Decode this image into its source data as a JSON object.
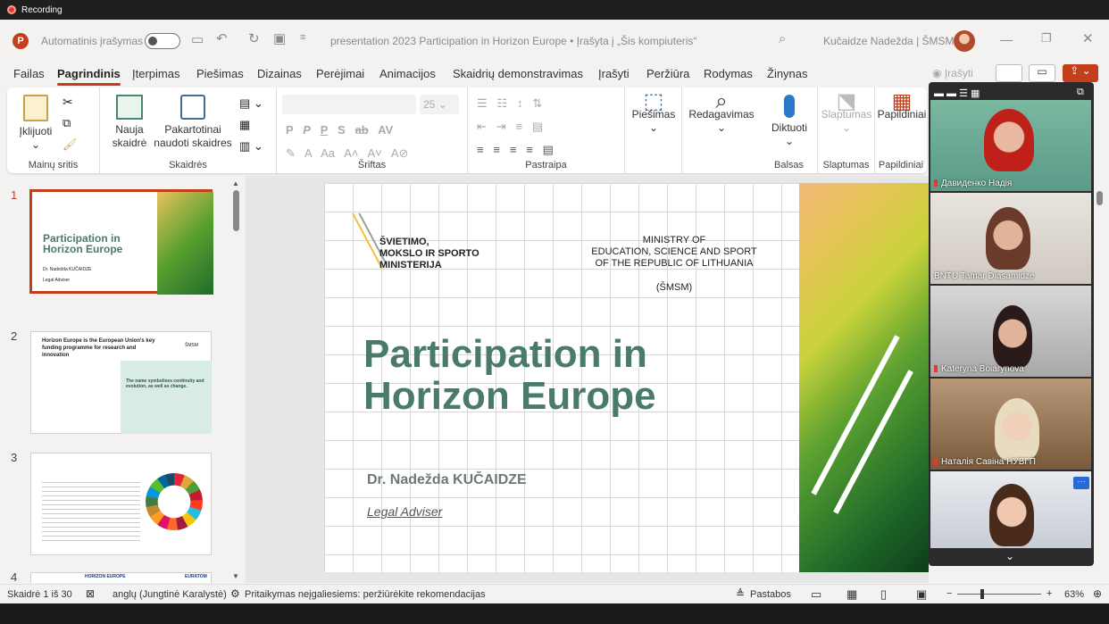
{
  "recording": {
    "label": "Recording"
  },
  "titlebar": {
    "autosave_label": "Automatinis įrašymas",
    "doc_title": "presentation 2023 Participation in Horizon Europe • Įrašyta į „Šis kompiuteris“",
    "user": "Kučaidze Nadežda | ŠMSM"
  },
  "menu": {
    "tabs": [
      "Failas",
      "Pagrindinis",
      "Įterpimas",
      "Piešimas",
      "Dizainas",
      "Perėjimai",
      "Animacijos",
      "Skaidrių demonstravimas",
      "Įrašyti",
      "Peržiūra",
      "Rodymas",
      "Žinynas"
    ],
    "record_label": "Įrašyti"
  },
  "ribbon": {
    "paste": "Įklijuoti",
    "clipboard_group": "Mainų sritis",
    "new_slide": "Nauja skaidrė",
    "reuse_slides": "Pakartotinai naudoti skaidres",
    "slides_group": "Skaidrės",
    "font_size": "25",
    "font_group": "Šriftas",
    "paragraph_group": "Pastraipa",
    "drawing": "Piešimas",
    "editing": "Redagavimas",
    "dictate": "Diktuoti",
    "voice_group": "Balsas",
    "sensitivity": "Slaptumas",
    "sensitivity_group": "Slaptumas",
    "addins": "Papildiniai",
    "addins_group": "Papildiniai"
  },
  "thumbnails": [
    {
      "num": "1",
      "title": "Participation in Horizon Europe",
      "author": "Dr. Nadežda KUČAIDZE",
      "role": "Legal Adviser"
    },
    {
      "num": "2",
      "heading": "Horizon Europe is the European Union's key funding programme for research and innovation",
      "tag": "ŠMSM",
      "note": "The name symbolises continuity and evolution, as well as change."
    },
    {
      "num": "3"
    },
    {
      "num": "4",
      "left": "HORIZON EUROPE",
      "right": "EURATOM"
    }
  ],
  "slide": {
    "ministry_lt": [
      "ŠVIETIMO,",
      "MOKSLO IR SPORTO",
      "MINISTERIJA"
    ],
    "ministry_en": [
      "MINISTRY OF",
      "EDUCATION, SCIENCE AND SPORT",
      "OF THE REPUBLIC OF LITHUANIA"
    ],
    "abbr": "(ŠMSM)",
    "title_line1": "Participation in",
    "title_line2": "Horizon Europe",
    "author": "Dr. Nadežda KUČAIDZE",
    "role": "Legal Adviser"
  },
  "participants": [
    {
      "name": "Давиденко Надія",
      "muted": true
    },
    {
      "name": "BNTU Tamar Diasamidze",
      "muted": false
    },
    {
      "name": "Kateryna Boiarynova",
      "muted": true
    },
    {
      "name": "Наталія Савіна НУВГП",
      "muted": true
    },
    {
      "name": "",
      "muted": false
    }
  ],
  "status": {
    "slide_counter": "Skaidrė 1 iš 30",
    "language": "anglų (Jungtinė Karalystė)",
    "accessibility": "Pritaikymas neįgaliesiems: peržiūrėkite rekomendacijas",
    "notes": "Pastabos",
    "zoom": "63%"
  },
  "colors": {
    "accent": "#c43e1c",
    "title_green": "#4a7a6a"
  }
}
